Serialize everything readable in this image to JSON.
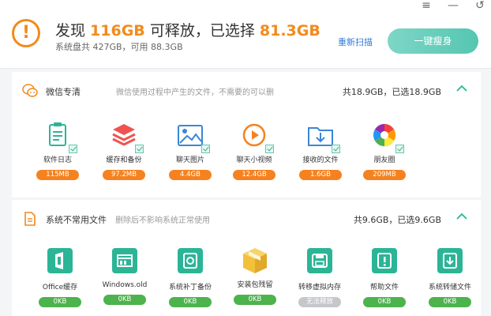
{
  "window": {
    "menu_icon": "≡",
    "minimize_icon": "—",
    "back_icon": "↺"
  },
  "header": {
    "prefix": "发现 ",
    "found_size": "116GB",
    "middle": " 可释放，已选择 ",
    "selected_size": "81.3GB",
    "disk_info": "系统盘共 427GB，可用 88.3GB",
    "rescan_label": "重新扫描",
    "slim_label": "一键瘦身",
    "accent_color": "#f28a1c"
  },
  "sections": [
    {
      "title": "微信专清",
      "desc": "微信使用过程中产生的文件，不需要的可以删",
      "summary": "共18.9GB，已选18.9GB",
      "items": [
        {
          "icon": "log-icon",
          "label": "软件日志",
          "size": "115MB"
        },
        {
          "icon": "cache-layers-icon",
          "label": "缓存和备份",
          "size": "97.2MB"
        },
        {
          "icon": "image-icon",
          "label": "聊天图片",
          "size": "4.4GB"
        },
        {
          "icon": "video-play-icon",
          "label": "聊天小视频",
          "size": "12.4GB"
        },
        {
          "icon": "download-folder-icon",
          "label": "接收的文件",
          "size": "1.6GB"
        },
        {
          "icon": "moments-aperture-icon",
          "label": "朋友圈",
          "size": "209MB"
        }
      ]
    },
    {
      "title": "系统不常用文件",
      "desc": "删除后不影响系统正常使用",
      "summary": "共9.6GB，已选9.6GB",
      "items": [
        {
          "icon": "office-icon",
          "label": "Office缓存",
          "size": "0KB"
        },
        {
          "icon": "windows-old-icon",
          "label": "Windows.old",
          "size": "0KB"
        },
        {
          "icon": "patch-backup-icon",
          "label": "系统补丁备份",
          "size": "0KB"
        },
        {
          "icon": "package-box-icon",
          "label": "安装包残留",
          "size": "0KB"
        },
        {
          "icon": "virtual-memory-icon",
          "label": "转移虚拟内存",
          "size": "无法释放"
        },
        {
          "icon": "help-file-icon",
          "label": "帮助文件",
          "size": "0KB"
        },
        {
          "icon": "system-storage-icon",
          "label": "系统转储文件",
          "size": "0KB"
        }
      ]
    }
  ]
}
